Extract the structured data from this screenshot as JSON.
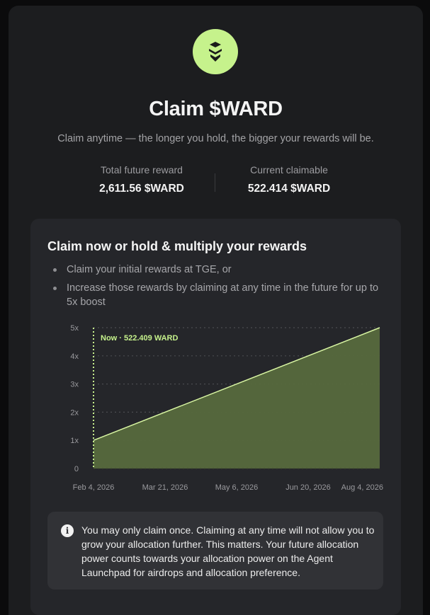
{
  "header": {
    "logo_icon": "ward-stacked-chevron-logo",
    "accent_color": "#c6f28c",
    "title": "Claim $WARD",
    "subtitle": "Claim anytime — the longer you hold, the bigger your rewards will be."
  },
  "stats": {
    "total_label": "Total future reward",
    "total_value": "2,611.56 $WARD",
    "claimable_label": "Current claimable",
    "claimable_value": "522.414 $WARD"
  },
  "card": {
    "title": "Claim now or hold & multiply your rewards",
    "bullets": [
      "Claim your initial rewards at TGE, or",
      "Increase those rewards by claiming at any time in the future for up to 5x boost"
    ]
  },
  "chart_data": {
    "type": "area",
    "x": [
      "Feb 4, 2026",
      "Aug 4, 2026"
    ],
    "y": [
      1,
      5
    ],
    "xticks": [
      "Feb 4, 2026",
      "Mar 21, 2026",
      "May 6, 2026",
      "Jun 20, 2026",
      "Aug 4, 2026"
    ],
    "yticks": [
      "0",
      "1x",
      "2x",
      "3x",
      "4x",
      "5x"
    ],
    "ylim": [
      0,
      5
    ],
    "grid": true,
    "line_color": "#d8f5a2",
    "fill_color": "#56693d",
    "now_marker": {
      "x": "Feb 4, 2026",
      "label": "Now · 522.409 WARD"
    }
  },
  "notice": {
    "icon": "info-icon",
    "text": "You may only claim once. Claiming at any time will not allow you to grow your allocation further. This matters. Your future allocation power counts towards your allocation power on the Agent Launchpad for airdrops and allocation preference."
  }
}
